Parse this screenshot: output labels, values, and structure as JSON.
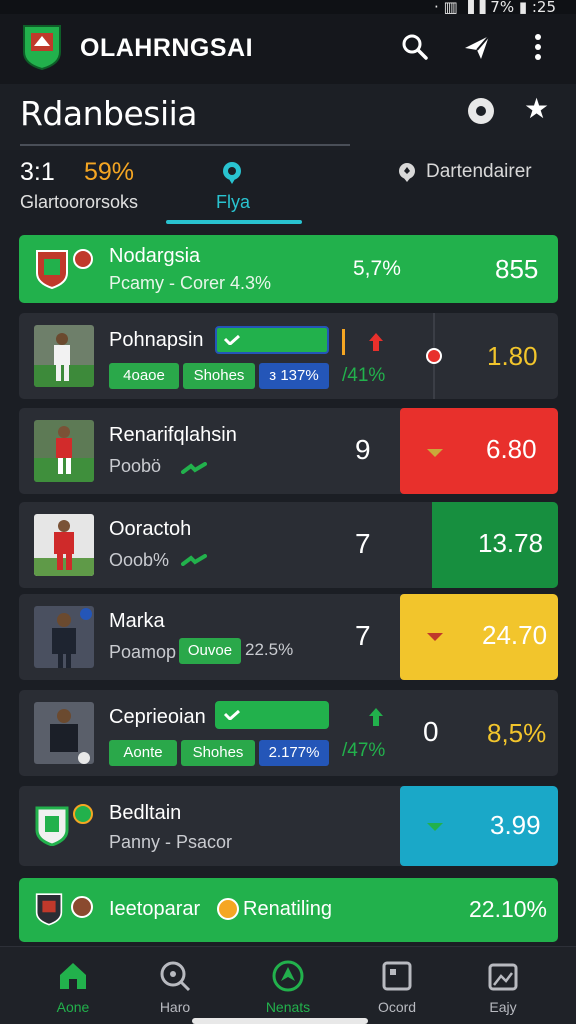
{
  "status": {
    "text": "· ▥ ▐▐ 7% ▮ :25"
  },
  "app": {
    "title": "OLAHRNGSAI",
    "icons": [
      "search-icon",
      "send-icon",
      "more-vert-icon"
    ]
  },
  "subheader": {
    "title": "Rdanbesiia",
    "icons": [
      "record-icon",
      "star-icon"
    ]
  },
  "tabs": {
    "score": "3:1",
    "score_pct": "59%",
    "left_label": "Glartoororsoks",
    "mid_label": "Flya",
    "right_label": "Dartendairer"
  },
  "rows": [
    {
      "title": "Nodargsia",
      "sub": "Pcamy - Corer 4.3%",
      "pct": "5,7%",
      "odds": "855"
    },
    {
      "title": "Pohnapsin",
      "chip1": "4oaoe",
      "chip2": "Shohes",
      "chip3": "з 137%",
      "side": "/41%",
      "odds": "1.80"
    },
    {
      "title": "Renarifqlahsin",
      "sub": "Poobö",
      "num": "9",
      "odds": "6.80"
    },
    {
      "title": "Ooractoh",
      "sub": "Ooob%",
      "num": "7",
      "odds": "13.78"
    },
    {
      "title": "Marka",
      "sub": "Poamop",
      "chip": "Ouvoe",
      "sub2": "22.5%",
      "num": "7",
      "odds": "24.70"
    },
    {
      "title": "Ceprieoian",
      "chip1": "Aonte",
      "chip2": "Shohes",
      "chip3": "2.177%",
      "side": "/47%",
      "num": "0",
      "odds": "8,5%"
    },
    {
      "title": "Bedltain",
      "sub": "Panny - Psacor",
      "odds": "3.99"
    },
    {
      "title": "Ieetoparar",
      "tag": "Renatiling",
      "odds": "22.10%"
    }
  ],
  "colors": {
    "green": "#22b14c",
    "red": "#e8302c",
    "dark_green": "#178f3f",
    "yellow": "#f2c52c",
    "teal": "#1aa8c8",
    "accent": "#29c3d0",
    "orange": "#f5a623"
  },
  "bottom_nav": [
    {
      "label": "Aone",
      "icon": "home-icon",
      "active": true
    },
    {
      "label": "Haro",
      "icon": "search-icon",
      "active": false
    },
    {
      "label": "Nenats",
      "icon": "compass-icon",
      "active": false
    },
    {
      "label": "Ocord",
      "icon": "square-icon",
      "active": false
    },
    {
      "label": "Eajy",
      "icon": "image-icon",
      "active": false
    }
  ]
}
